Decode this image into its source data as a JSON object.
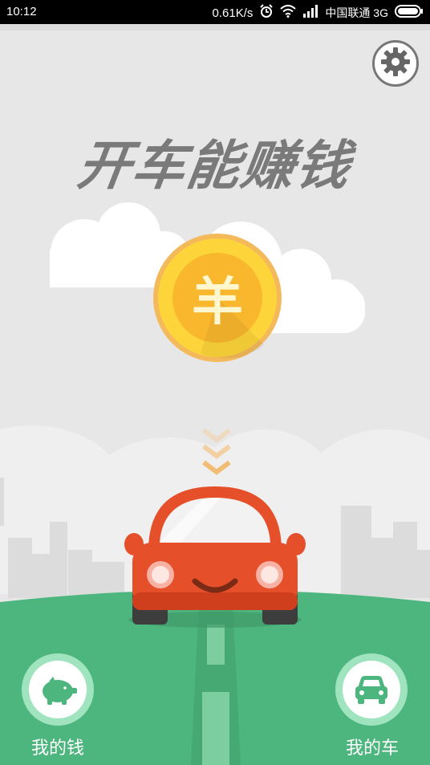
{
  "status_bar": {
    "time": "10:12",
    "network_speed": "0.61K/s",
    "carrier": "中国联通 3G",
    "icons": [
      "alarm-icon",
      "wifi-icon",
      "signal-icon",
      "battery-icon"
    ]
  },
  "main": {
    "headline": "开车能赚钱",
    "coin_symbol": "羊",
    "settings_icon": "gear-icon"
  },
  "bottom_nav": {
    "left": {
      "label": "我的钱",
      "icon": "piggy-bank-icon"
    },
    "right": {
      "label": "我的车",
      "icon": "car-icon"
    }
  },
  "colors": {
    "background": "#e7e7e7",
    "grass": "#4db57e",
    "coin": "#fdc830",
    "car": "#e5502b",
    "headline": "#7a7a7a"
  }
}
